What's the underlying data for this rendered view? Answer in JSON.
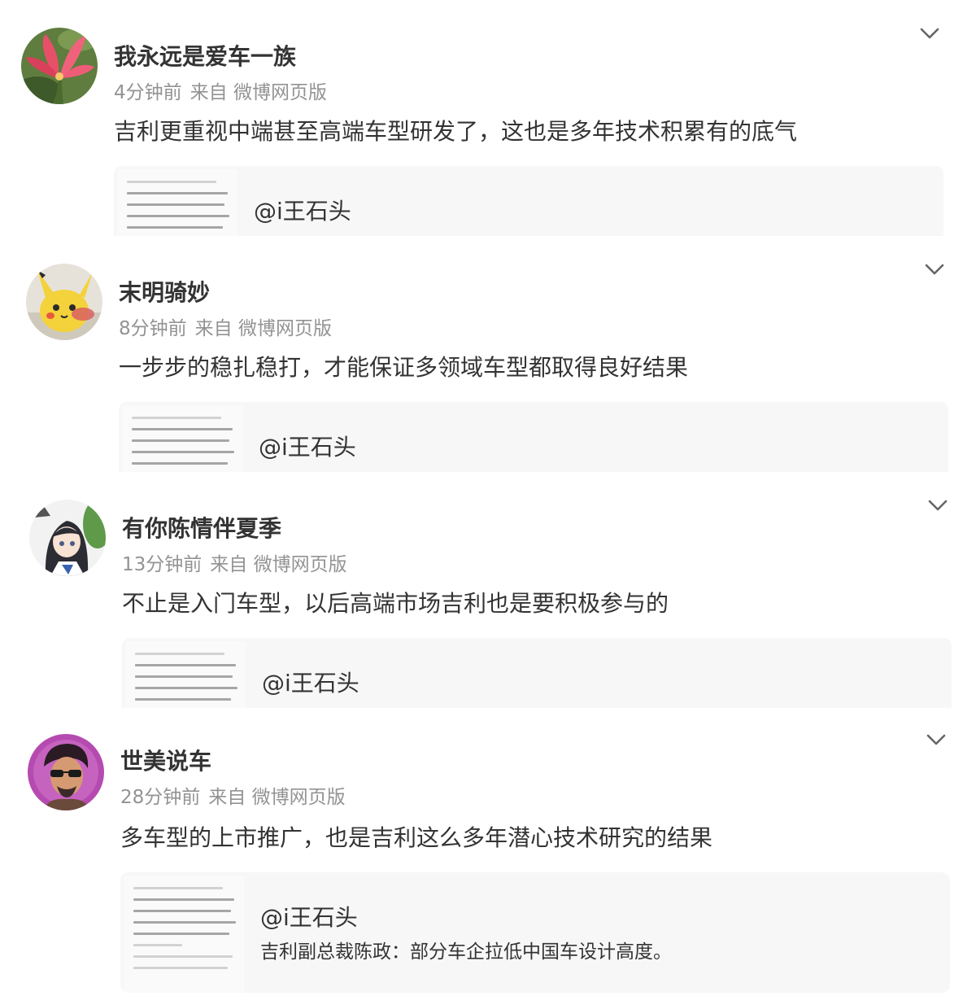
{
  "posts": [
    {
      "username": "我永远是爱车一族",
      "time": "4分钟前",
      "source": "来自 微博网页版",
      "content": "吉利更重视中端甚至高端车型研发了，这也是多年技术积累有的底气",
      "card": {
        "title": "@i王石头",
        "desc": ""
      },
      "avatar_icon": "pink-flower-avatar",
      "more_icon": "chevron-down-icon"
    },
    {
      "username": "末明骑妙",
      "time": "8分钟前",
      "source": "来自 微博网页版",
      "content": "一步步的稳扎稳打，才能保证多领域车型都取得良好结果",
      "card": {
        "title": "@i王石头",
        "desc": ""
      },
      "avatar_icon": "pikachu-avatar",
      "more_icon": "chevron-down-icon"
    },
    {
      "username": "有你陈情伴夏季",
      "time": "13分钟前",
      "source": "来自 微博网页版",
      "content": "不止是入门车型，以后高端市场吉利也是要积极参与的",
      "card": {
        "title": "@i王石头",
        "desc": ""
      },
      "avatar_icon": "anime-girl-avatar",
      "more_icon": "chevron-down-icon"
    },
    {
      "username": "世美说车",
      "time": "28分钟前",
      "source": "来自 微博网页版",
      "content": "多车型的上市推广，也是吉利这么多年潜心技术研究的结果",
      "card": {
        "title": "@i王石头",
        "desc": "吉利副总裁陈政：部分车企拉低中国车设计高度。"
      },
      "avatar_icon": "sunglasses-man-avatar",
      "more_icon": "chevron-down-icon"
    }
  ],
  "colors": {
    "text": "#333333",
    "meta": "#939393",
    "card_bg": "#f7f7f7"
  }
}
